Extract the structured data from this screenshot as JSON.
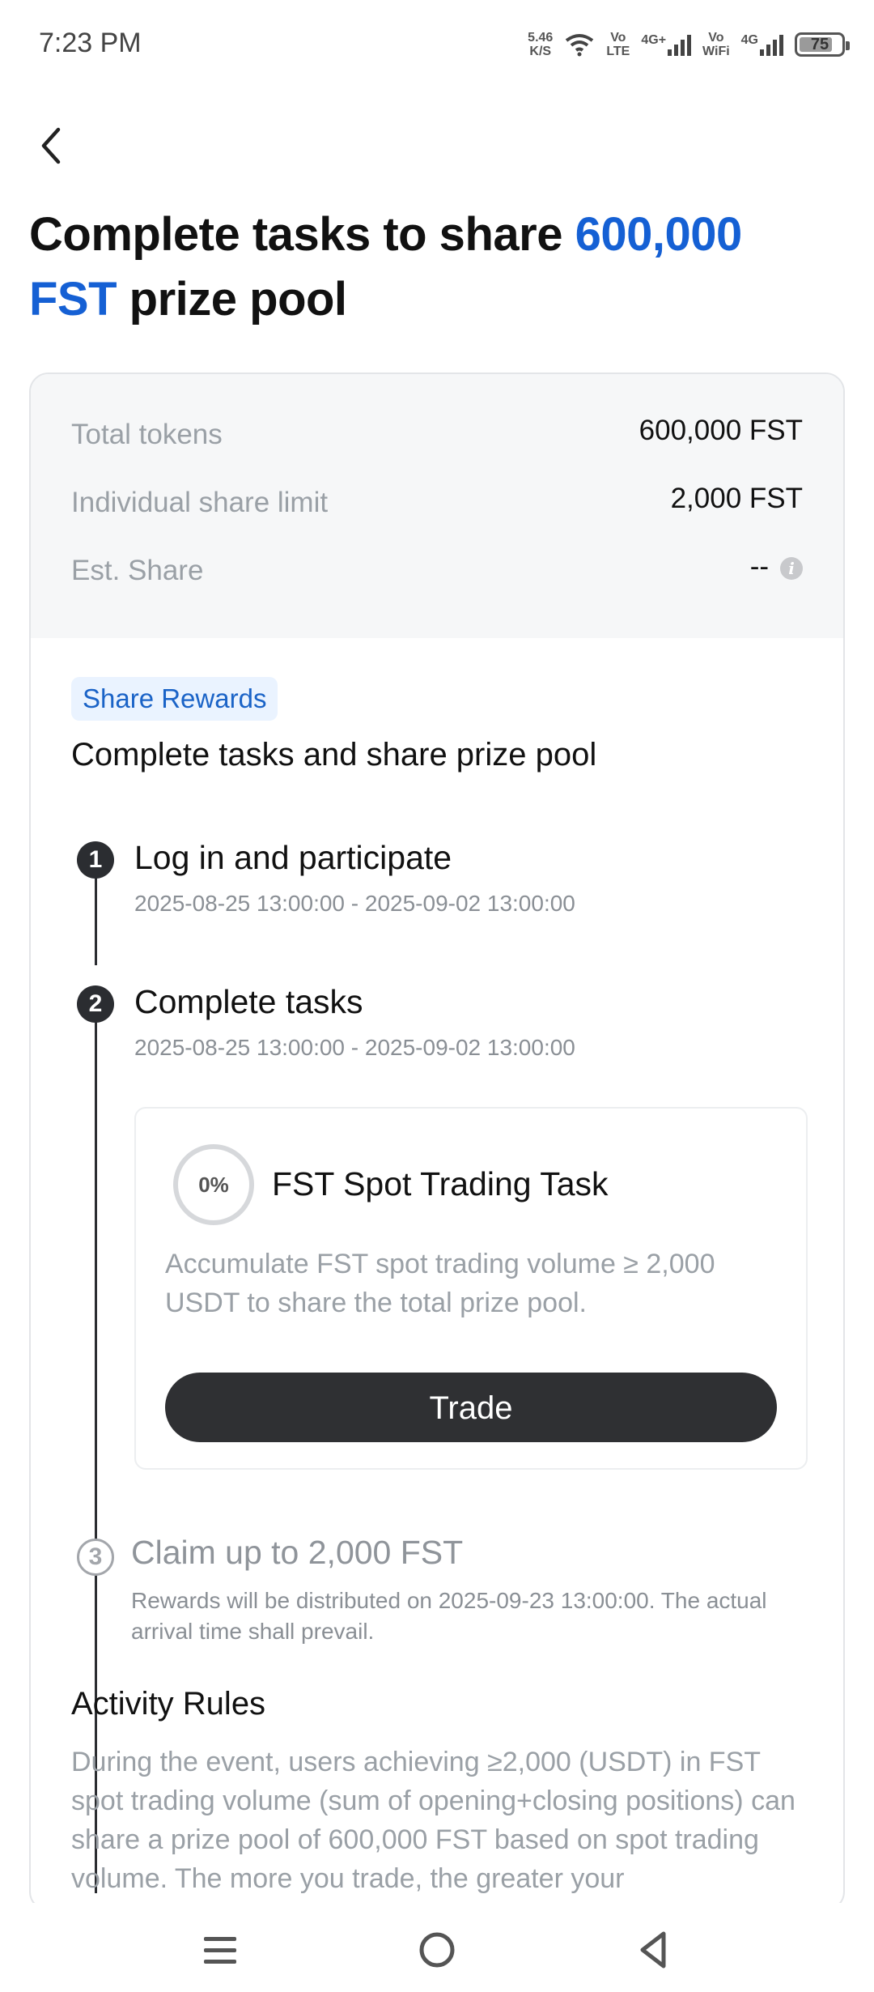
{
  "status_bar": {
    "time": "7:23 PM",
    "net_speed_value": "5.46",
    "net_speed_unit": "K/S",
    "volte_top": "Vo",
    "volte_bottom": "LTE",
    "net1": "4G+",
    "vowifi_top": "Vo",
    "vowifi_bottom": "WiFi",
    "net2": "4G",
    "battery": "75"
  },
  "header": {
    "title_part1": "Complete tasks to share ",
    "title_highlight": "600,000 FST",
    "title_part2": " prize pool",
    "accent_color": "#1560d4"
  },
  "summary": {
    "rows": [
      {
        "label": "Total tokens",
        "value": "600,000 FST"
      },
      {
        "label": "Individual share limit",
        "value": "2,000 FST"
      },
      {
        "label": "Est. Share",
        "value": "--"
      }
    ],
    "info_icon": "i"
  },
  "rewards": {
    "badge": "Share Rewards",
    "subheading": "Complete tasks and share prize pool"
  },
  "steps": [
    {
      "num": "1",
      "title": "Log in and participate",
      "date": "2025-08-25 13:00:00 - 2025-09-02 13:00:00"
    },
    {
      "num": "2",
      "title": "Complete tasks",
      "date": "2025-08-25 13:00:00 - 2025-09-02 13:00:00"
    },
    {
      "num": "3",
      "title": "Claim up to 2,000 FST",
      "desc": "Rewards will be distributed on 2025-09-23 13:00:00. The actual arrival time shall prevail."
    }
  ],
  "task": {
    "progress": "0%",
    "title": "FST Spot Trading Task",
    "description": "Accumulate FST spot trading volume ≥ 2,000 USDT to share the total prize pool.",
    "button": "Trade"
  },
  "rules": {
    "title": "Activity Rules",
    "text": "During the event, users achieving ≥2,000 (USDT) in FST spot trading volume (sum of opening+closing positions) can share a prize pool of 600,000 FST based on spot trading volume. The more you trade, the greater your"
  }
}
